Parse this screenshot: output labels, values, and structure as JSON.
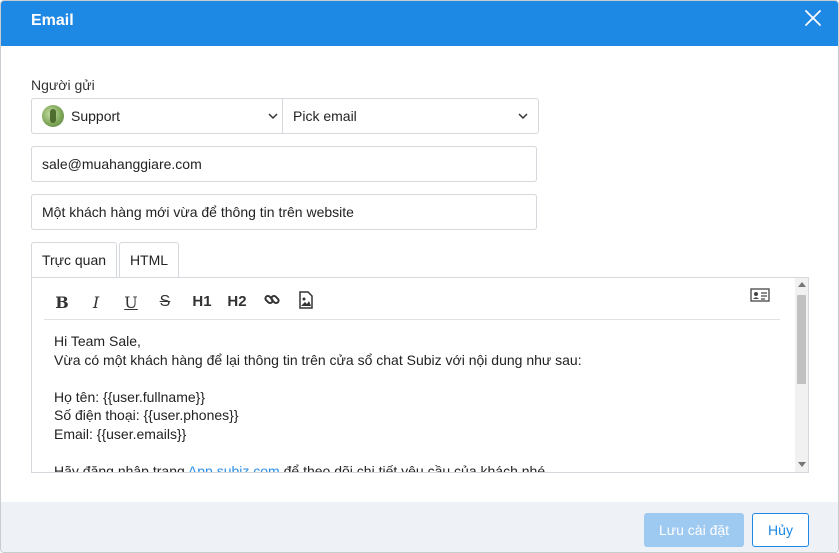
{
  "header": {
    "title": "Email",
    "close_icon": "close-icon"
  },
  "sender": {
    "label": "Người gửi",
    "agent_select": {
      "value": "Support",
      "icon": "agent-avatar"
    },
    "email_select": {
      "value": "Pick email"
    }
  },
  "from_email": {
    "value": "sale@muahanggiare.com"
  },
  "subject": {
    "value": "Một khách hàng mới vừa để thông tin trên website"
  },
  "tabs": [
    {
      "label": "Trực quan",
      "active": true
    },
    {
      "label": "HTML",
      "active": false
    }
  ],
  "toolbar": {
    "bold": "B",
    "italic": "I",
    "underline": "U",
    "strike": "S",
    "h1": "H1",
    "h2": "H2",
    "link_icon": "link-icon",
    "image_icon": "image-icon",
    "template_icon": "contact-card-icon"
  },
  "body": {
    "line1": "Hi Team Sale,",
    "line2": "Vừa có một khách hàng để lại thông tin trên cửa sổ chat Subiz với nội dung như sau:",
    "line3": "Họ tên: {{user.fullname}}",
    "line4": "Số điện thoại: {{user.phones}}",
    "line5": "Email: {{user.emails}}",
    "line6_before": "Hãy đăng nhập trang ",
    "line6_link": "App.subiz.com",
    "line6_after": " để theo dõi chi tiết yêu cầu của khách nhé."
  },
  "footer": {
    "save_label": "Lưu cài đặt",
    "cancel_label": "Hủy"
  },
  "colors": {
    "primary": "#1e88e5",
    "save_disabled": "#9ec9f1",
    "link": "#2b8ee6",
    "footer_bg": "#eef2f7"
  }
}
